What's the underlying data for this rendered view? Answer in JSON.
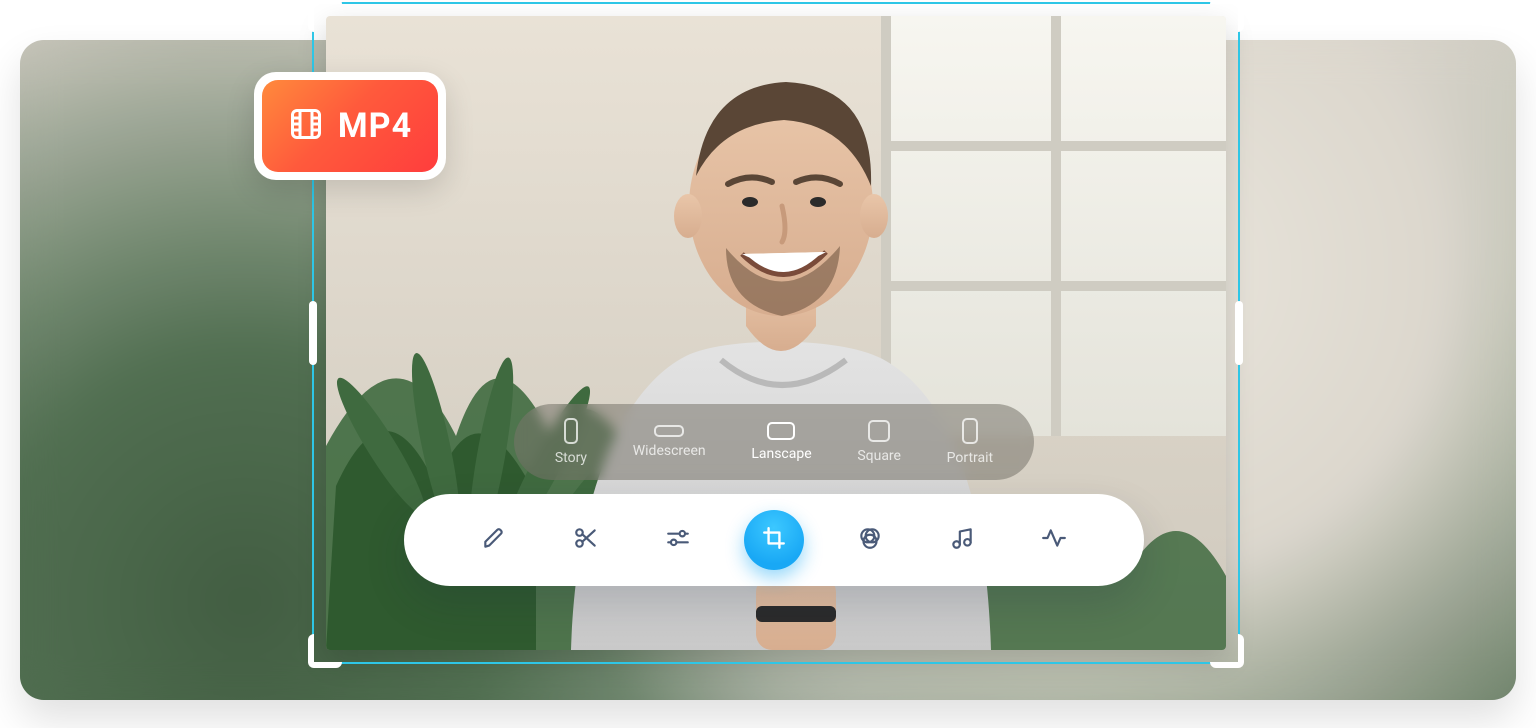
{
  "badge": {
    "format_label": "MP4"
  },
  "colors": {
    "crop_border": "#2ec6e6",
    "accent": "#19a8f5",
    "badge_gradient_start": "#ff8a3c",
    "badge_gradient_end": "#ff3d3d",
    "toolbar_icon": "#4a5a78"
  },
  "aspect_ratios": {
    "items": [
      {
        "id": "story",
        "label": "Story"
      },
      {
        "id": "widescreen",
        "label": "Widescreen"
      },
      {
        "id": "landscape",
        "label": "Lanscape"
      },
      {
        "id": "square",
        "label": "Square"
      },
      {
        "id": "portrait",
        "label": "Portrait"
      }
    ],
    "active_id": "landscape"
  },
  "tools": {
    "items": [
      {
        "id": "draw",
        "icon": "pencil-icon"
      },
      {
        "id": "trim",
        "icon": "scissors-icon"
      },
      {
        "id": "adjust",
        "icon": "sliders-icon"
      },
      {
        "id": "crop",
        "icon": "crop-icon"
      },
      {
        "id": "filters",
        "icon": "venn-icon"
      },
      {
        "id": "audio",
        "icon": "music-note-icon"
      },
      {
        "id": "effects",
        "icon": "waveform-icon"
      }
    ],
    "active_id": "crop"
  }
}
